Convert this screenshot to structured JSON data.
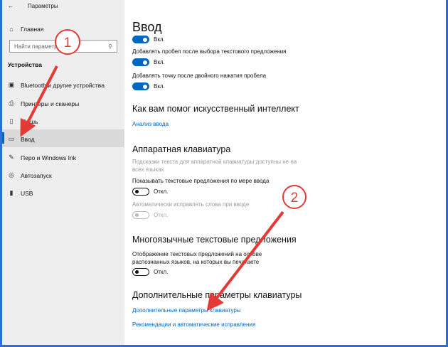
{
  "window": {
    "title": "Параметры"
  },
  "sidebar": {
    "home": "Главная",
    "search_placeholder": "Найти параметр",
    "section": "Устройства",
    "items": [
      {
        "label": "Bluetooth и другие устройства"
      },
      {
        "label": "Принтеры и сканеры"
      },
      {
        "label": "Мышь"
      },
      {
        "label": "Ввод"
      },
      {
        "label": "Перо и Windows Ink"
      },
      {
        "label": "Автозапуск"
      },
      {
        "label": "USB"
      }
    ]
  },
  "main": {
    "title": "Ввод",
    "toggle0": {
      "state": "Вкл."
    },
    "toggle1": {
      "label": "Добавлять пробел после выбора текстового предложения",
      "state": "Вкл."
    },
    "toggle2": {
      "label": "Добавлять точку после двойного нажатия пробела",
      "state": "Вкл."
    },
    "ai": {
      "heading": "Как вам помог искусственный интеллект",
      "link": "Анализ ввода"
    },
    "hw": {
      "heading": "Аппаратная клавиатура",
      "note": "Подсказки текста для аппаратной клавиатуры доступны не на всех языках",
      "t1": {
        "label": "Показывать текстовые предложения по мере ввода",
        "state": "Откл."
      },
      "t2": {
        "label": "Автоматически исправлять слова при вводе",
        "state": "Откл."
      }
    },
    "multi": {
      "heading": "Многоязычные текстовые предложения",
      "label": "Отображение текстовых предложений на основе распознанных языков, на которых вы печатаете",
      "state": "Откл."
    },
    "extra": {
      "heading": "Дополнительные параметры клавиатуры",
      "link1": "Дополнительные параметры клавиатуры",
      "link2": "Рекомендации и автоматические исправления"
    }
  },
  "annotations": {
    "step1": "1",
    "step2": "2",
    "color": "#e53935"
  }
}
